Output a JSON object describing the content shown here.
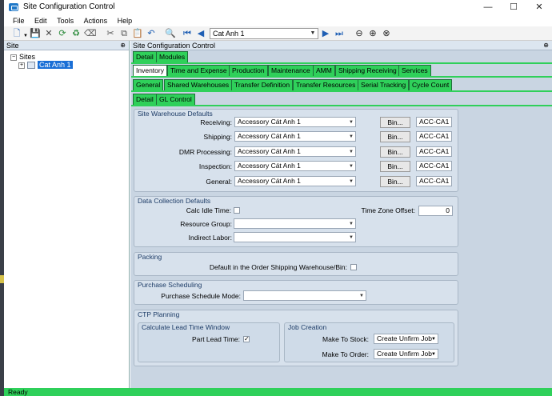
{
  "window": {
    "title": "Site Configuration Control",
    "minimize": "—",
    "maximize": "☐",
    "close": "✕"
  },
  "menu": [
    "File",
    "Edit",
    "Tools",
    "Actions",
    "Help"
  ],
  "toolbar": {
    "nav_value": "Cat Anh 1"
  },
  "site_panel": {
    "title": "Site",
    "pin": "⊕",
    "tree": {
      "root": "Sites",
      "child": "Cat Anh 1"
    }
  },
  "config_panel": {
    "title": "Site Configuration Control",
    "pin": "⊕"
  },
  "tabs": {
    "row1": [
      "Detail",
      "Modules"
    ],
    "row2": [
      "Inventory",
      "Time and Expense",
      "Production",
      "Maintenance",
      "AMM",
      "Shipping Receiving",
      "Services"
    ],
    "row3": [
      "General",
      "Shared Warehouses",
      "Transfer Definition",
      "Transfer Resources",
      "Serial Tracking",
      "Cycle Count"
    ],
    "row4": [
      "Detail",
      "GL Control"
    ]
  },
  "site_warehouse_defaults": {
    "title": "Site Warehouse Defaults",
    "bin_label": "Bin...",
    "rows": [
      {
        "label": "Receiving:",
        "warehouse": "Accessory Cát Anh 1",
        "bin": "ACC-CA1"
      },
      {
        "label": "Shipping:",
        "warehouse": "Accessory Cát Anh 1",
        "bin": "ACC-CA1"
      },
      {
        "label": "DMR Processing:",
        "warehouse": "Accessory Cát Anh 1",
        "bin": "ACC-CA1"
      },
      {
        "label": "Inspection:",
        "warehouse": "Accessory Cát Anh 1",
        "bin": "ACC-CA1"
      },
      {
        "label": "General:",
        "warehouse": "Accessory Cát Anh 1",
        "bin": "ACC-CA1"
      }
    ]
  },
  "data_collection": {
    "title": "Data Collection Defaults",
    "calc_idle_label": "Calc Idle Time:",
    "time_zone_label": "Time Zone Offset:",
    "time_zone_value": "0",
    "resource_group_label": "Resource Group:",
    "indirect_labor_label": "Indirect Labor:"
  },
  "packing": {
    "title": "Packing",
    "default_label": "Default in the Order Shipping Warehouse/Bin:"
  },
  "purchase_scheduling": {
    "title": "Purchase Scheduling",
    "mode_label": "Purchase Schedule Mode:"
  },
  "ctp_planning": {
    "title": "CTP Planning",
    "lead_time_title": "Calculate Lead Time Window",
    "part_lead_time_label": "Part Lead Time:",
    "part_lead_time_checked": "✓",
    "job_creation_title": "Job Creation",
    "make_to_stock_label": "Make To Stock:",
    "make_to_stock_value": "Create Unfirm Job",
    "make_to_order_label": "Make To Order:",
    "make_to_order_value": "Create Unfirm Job"
  },
  "status": {
    "text": "Ready"
  }
}
